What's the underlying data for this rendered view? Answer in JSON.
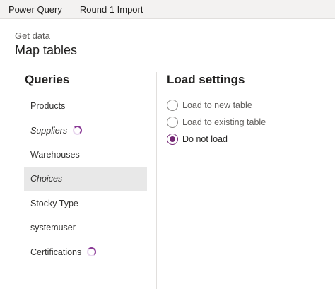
{
  "topbar": {
    "app_name": "Power Query",
    "breadcrumb": "Round 1 Import"
  },
  "header": {
    "subtitle": "Get data",
    "title": "Map tables"
  },
  "queries": {
    "heading": "Queries",
    "items": [
      {
        "label": "Products"
      },
      {
        "label": "Suppliers"
      },
      {
        "label": "Warehouses"
      },
      {
        "label": "Choices"
      },
      {
        "label": "Stocky Type"
      },
      {
        "label": "systemuser"
      },
      {
        "label": "Certifications"
      }
    ]
  },
  "load_settings": {
    "heading": "Load settings",
    "options": [
      {
        "label": "Load to new table"
      },
      {
        "label": "Load to existing table"
      },
      {
        "label": "Do not load"
      }
    ],
    "selected": "Do not load"
  },
  "colors": {
    "accent": "#742774",
    "spinner": "#8a3a96",
    "selected_row": "#e8e8e8"
  }
}
